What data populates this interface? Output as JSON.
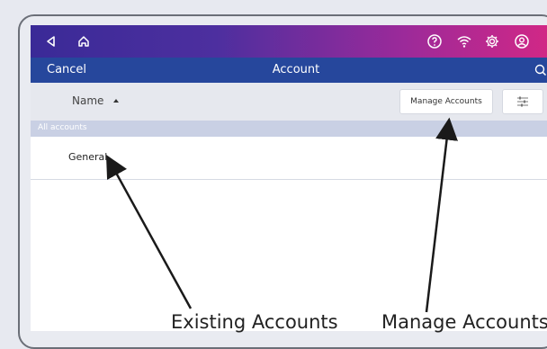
{
  "status_bar": {
    "icons": [
      "back-icon",
      "home-icon",
      "help-icon",
      "wifi-icon",
      "settings-icon",
      "user-icon"
    ]
  },
  "nav": {
    "cancel_label": "Cancel",
    "title": "Account",
    "search_icon": "search-icon"
  },
  "toolbar": {
    "sort_label": "Name",
    "sort_direction": "ascending",
    "manage_label": "Manage Accounts",
    "filter_icon": "filter-sliders-icon"
  },
  "list": {
    "section_header": "All accounts",
    "items": [
      {
        "label": "General"
      }
    ]
  },
  "annotations": {
    "existing": "Existing Accounts",
    "manage": "Manage Accounts"
  },
  "colors": {
    "gradient_start": "#3a2a97",
    "gradient_end": "#d62784",
    "nav_blue": "#26479c",
    "section_header": "#c9d0e4"
  }
}
